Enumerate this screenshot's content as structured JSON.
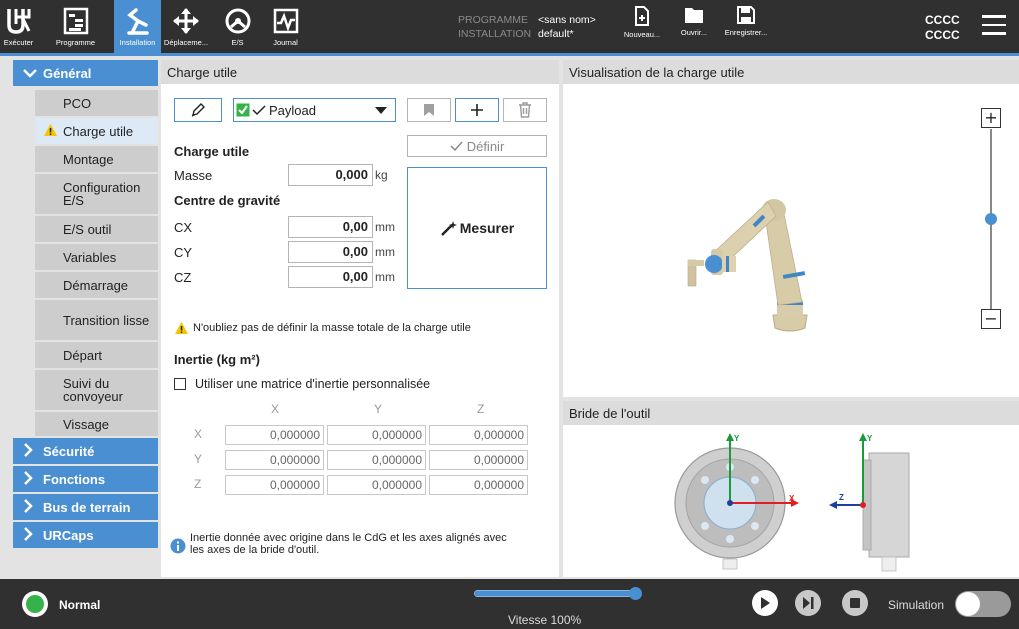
{
  "topbar": {
    "nav": [
      {
        "label": "Exécuter"
      },
      {
        "label": "Programme"
      },
      {
        "label": "Installation"
      },
      {
        "label": "Déplaceme..."
      },
      {
        "label": "E/S"
      },
      {
        "label": "Journal"
      }
    ],
    "program_key": "PROGRAMME",
    "program_value": "<sans nom>",
    "installation_key": "INSTALLATION",
    "installation_value": "default*",
    "file_buttons": {
      "new": "Nouveau...",
      "open": "Ouvrir...",
      "save": "Enregistrer..."
    },
    "user_line1": "CCCC",
    "user_line2": "CCCC"
  },
  "sidebar": {
    "general": "Général",
    "items": [
      {
        "label": "PCO"
      },
      {
        "label": "Charge utile"
      },
      {
        "label": "Montage"
      },
      {
        "label": "Configuration E/S"
      },
      {
        "label": "E/S outil"
      },
      {
        "label": "Variables"
      },
      {
        "label": "Démarrage"
      },
      {
        "label": "Transition lisse"
      },
      {
        "label": "Départ"
      },
      {
        "label": "Suivi du convoyeur"
      },
      {
        "label": "Vissage"
      }
    ],
    "sections": [
      {
        "label": "Sécurité"
      },
      {
        "label": "Fonctions"
      },
      {
        "label": "Bus de terrain"
      },
      {
        "label": "URCaps"
      }
    ]
  },
  "payload": {
    "title": "Charge utile",
    "selected": "Payload",
    "set_button": "Définir",
    "subtitle": "Charge utile",
    "mass_label": "Masse",
    "mass_value": "0,000",
    "mass_unit": "kg",
    "cog_title": "Centre de gravité",
    "cx_label": "CX",
    "cx_value": "0,00",
    "cy_label": "CY",
    "cy_value": "0,00",
    "cz_label": "CZ",
    "cz_value": "0,00",
    "length_unit": "mm",
    "measure_button": "Mesurer",
    "warning": "N'oubliez pas de définir la masse totale de la charge utile",
    "inertia_title": "Inertie (kg m²)",
    "custom_matrix_label": "Utiliser une matrice d'inertie personnalisée",
    "custom_matrix_checked": false,
    "matrix_cols": [
      "X",
      "Y",
      "Z"
    ],
    "matrix_rows": [
      {
        "label": "X",
        "values": [
          "0,000000",
          "0,000000",
          "0,000000"
        ]
      },
      {
        "label": "Y",
        "values": [
          "0,000000",
          "0,000000",
          "0,000000"
        ]
      },
      {
        "label": "Z",
        "values": [
          "0,000000",
          "0,000000",
          "0,000000"
        ]
      }
    ],
    "info_line1": "Inertie donnée avec origine dans le CdG et les axes alignés avec",
    "info_line2": "les axes de la bride d'outil."
  },
  "visualization": {
    "title": "Visualisation de la charge utile",
    "zoom_level": 0.5
  },
  "flange": {
    "title": "Bride de l'outil",
    "axes": {
      "x": "X",
      "y": "Y",
      "z": "Z"
    }
  },
  "bottombar": {
    "status": "Normal",
    "speed_label": "Vitesse 100%",
    "speed_value": 1.0,
    "simulation_label": "Simulation",
    "simulation_on": false
  },
  "colors": {
    "accent": "#4a8fd2",
    "topbar": "#303030",
    "status_green": "#35b34a",
    "warning": "#f5c400",
    "axis_x": "#e02020",
    "axis_y": "#1a9a3a",
    "axis_z": "#1f3fa0"
  }
}
